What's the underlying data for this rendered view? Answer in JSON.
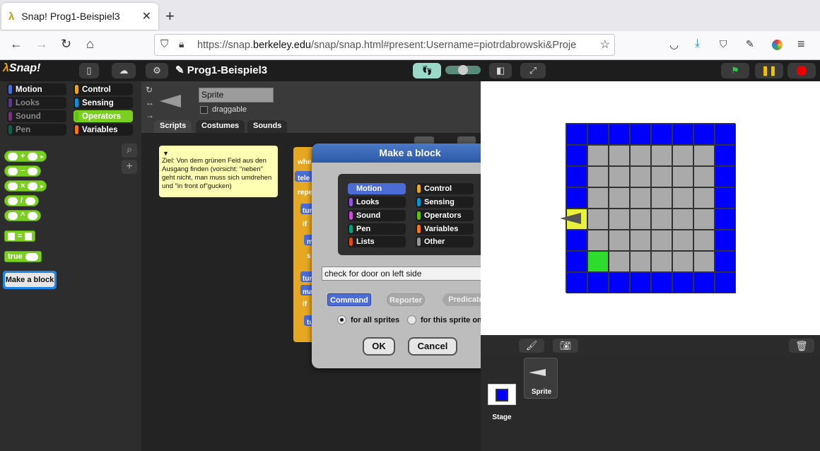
{
  "browser": {
    "tab_title": "Snap! Prog1-Beispiel3",
    "url_prefix": "https://snap.",
    "url_domain": "berkeley.edu",
    "url_rest": "/snap/snap.html#present:Username=piotrdabrowski&Proje"
  },
  "snap": {
    "logo_main": "Snap!",
    "project_title": "✎ Prog1-Beispiel3"
  },
  "categories": [
    {
      "label": "Motion",
      "color": "#4a6cd4"
    },
    {
      "label": "Control",
      "color": "#e6a822"
    },
    {
      "label": "Looks",
      "color": "#8f56e3"
    },
    {
      "label": "Sensing",
      "color": "#0494dc"
    },
    {
      "label": "Sound",
      "color": "#cf4ad9"
    },
    {
      "label": "Operators",
      "color": "#62c213"
    },
    {
      "label": "Pen",
      "color": "#00a178"
    },
    {
      "label": "Variables",
      "color": "#f3761d"
    }
  ],
  "palette": {
    "ops": [
      "+",
      "−",
      "×",
      "/",
      "^"
    ],
    "equals": "=",
    "true_label": "true",
    "make_block": "Make a block"
  },
  "sprite": {
    "name": "Sprite",
    "draggable_label": "draggable",
    "tabs": [
      "Scripts",
      "Costumes",
      "Sounds"
    ]
  },
  "comment": {
    "text": "Ziel: Von dem grünen Feld aus den Ausgang finden (vorsicht: \"neben\" geht nicht, man muss sich umdrehen und \"in front of\"gucken)"
  },
  "script_fragments": [
    "whe",
    "tele",
    "repe",
    "tur",
    "if",
    "m",
    "s",
    "tur",
    "ma",
    "if",
    "tu"
  ],
  "dialog": {
    "title": "Make a block",
    "categories": [
      "Motion",
      "Control",
      "Looks",
      "Sensing",
      "Sound",
      "Operators",
      "Pen",
      "Variables",
      "Lists",
      "Other"
    ],
    "category_colors": [
      "#4a6cd4",
      "#e6a822",
      "#8f56e3",
      "#0494dc",
      "#cf4ad9",
      "#62c213",
      "#00a178",
      "#f3761d",
      "#d94d11",
      "#969696"
    ],
    "selected_category": "Motion",
    "block_name": "check for door on left side",
    "shapes": [
      "Command",
      "Reporter",
      "Predicate"
    ],
    "selected_shape": "Command",
    "scope_all": "for all sprites",
    "scope_this": "for this sprite only",
    "scope_selected": "for all sprites",
    "ok": "OK",
    "cancel": "Cancel"
  },
  "stage_grid": {
    "rows": [
      "BBBBBBBB",
      "BGGGGGGB",
      "BGGGGGGB",
      "BGGGGGGB",
      "YGGGGGGB",
      "BGGGGGGB",
      "BLGGGGGB",
      "BBBBBBBB"
    ],
    "colors": {
      "B": "#0000ff",
      "G": "#aaaaaa",
      "Y": "#e8f23a",
      "L": "#2ddc2d"
    }
  },
  "corral": {
    "stage_label": "Stage",
    "sprite_label": "Sprite"
  }
}
